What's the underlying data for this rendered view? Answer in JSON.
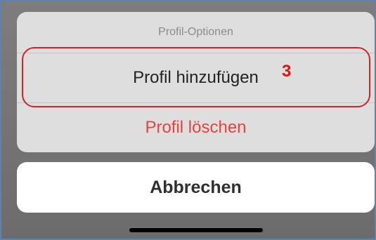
{
  "sheet": {
    "title": "Profil-Optionen",
    "actions": [
      {
        "label": "Profil hinzufügen",
        "style": "default",
        "color": "#222222"
      },
      {
        "label": "Profil löschen",
        "style": "destructive",
        "color": "#e6433e"
      }
    ]
  },
  "annotation": {
    "step_number": "3",
    "highlight_color": "#d52424"
  },
  "cancel": {
    "label": "Abbrechen"
  }
}
